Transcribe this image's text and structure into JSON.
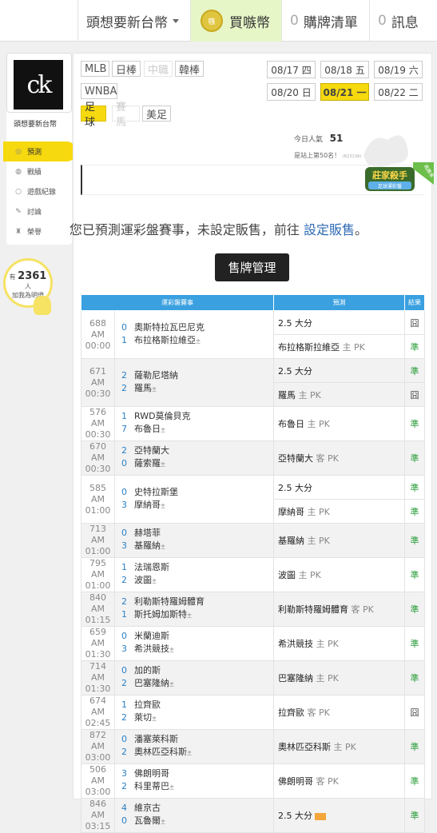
{
  "topbar": {
    "username": "頭想要新台幣",
    "buy_label": "買嗾幣",
    "coin_icon_text": "嗾",
    "cart_count": "0",
    "cart_label": "購牌清單",
    "msg_count": "0",
    "msg_label": "訊息"
  },
  "sidebar": {
    "avatar_text": "ck",
    "name": "頭想要新台幣",
    "menu": [
      {
        "label": "預測",
        "icon": "target-icon"
      },
      {
        "label": "戰績",
        "icon": "chat-icon"
      },
      {
        "label": "遊戲紀錄",
        "icon": "circle-icon"
      },
      {
        "label": "討論",
        "icon": "pencil-icon"
      },
      {
        "label": "榮譽",
        "icon": "medal-icon"
      }
    ],
    "fans_prefix": "有",
    "fans_count": "2361",
    "fans_suffix": "人",
    "fans_line2": "加我為明燈"
  },
  "leagues": [
    {
      "label": "MLB",
      "state": "normal"
    },
    {
      "label": "日棒",
      "state": "normal"
    },
    {
      "label": "中職",
      "state": "disabled"
    },
    {
      "label": "韓棒",
      "state": "normal"
    },
    {
      "label": "WNBA",
      "state": "normal"
    },
    {
      "label": "足球",
      "state": "active"
    },
    {
      "label": "賽馬",
      "state": "disabled"
    },
    {
      "label": "美足",
      "state": "normal"
    }
  ],
  "dates": [
    {
      "label": "08/17 四",
      "active": false
    },
    {
      "label": "08/18 五",
      "active": false
    },
    {
      "label": "08/19 六",
      "active": false
    },
    {
      "label": "08/20 日",
      "active": false
    },
    {
      "label": "08/21 一",
      "active": true
    },
    {
      "label": "08/22 二",
      "active": false
    }
  ],
  "popularity": {
    "label": "今日人氣",
    "value": "51",
    "rank_text": "是站上第50名！",
    "rank_code": "(R2313A)"
  },
  "badge": {
    "title": "莊家殺手",
    "sub": "足球運彩盤",
    "ribbon": "高勝率"
  },
  "notice": {
    "text": "您已預測運彩盤賽事，未設定販售，前往",
    "link": "設定販售",
    "end": "。"
  },
  "manage_button": "售牌管理",
  "table": {
    "headers": [
      "運彩盤賽事",
      "預測",
      "結果"
    ],
    "games": [
      {
        "id": "688",
        "time": "AM 00:00",
        "away": "奧斯特拉瓦巴尼克",
        "away_score": "0",
        "home": "布拉格斯拉維亞",
        "home_score": "1",
        "preds": [
          {
            "text": "2.5 大分",
            "pk": "",
            "result": "囧"
          },
          {
            "text": "布拉格斯拉維亞",
            "pk": "主 PK",
            "result": "準"
          }
        ]
      },
      {
        "id": "671",
        "time": "AM 00:30",
        "away": "薩勒尼塔納",
        "away_score": "2",
        "home": "羅馬",
        "home_score": "2",
        "preds": [
          {
            "text": "2.5 大分",
            "pk": "",
            "result": "準"
          },
          {
            "text": "羅馬",
            "pk": "主 PK",
            "result": "囧"
          }
        ]
      },
      {
        "id": "576",
        "time": "AM 00:30",
        "away": "RWD莫倫貝克",
        "away_score": "1",
        "home": "布魯日",
        "home_score": "7",
        "preds": [
          {
            "text": "布魯日",
            "pk": "主 PK",
            "result": "準"
          }
        ]
      },
      {
        "id": "670",
        "time": "AM 00:30",
        "away": "亞特蘭大",
        "away_score": "2",
        "home": "薩索羅",
        "home_score": "0",
        "preds": [
          {
            "text": "亞特蘭大",
            "pk": "客 PK",
            "result": "準"
          }
        ]
      },
      {
        "id": "585",
        "time": "AM 01:00",
        "away": "史特拉斯堡",
        "away_score": "0",
        "home": "摩納哥",
        "home_score": "3",
        "preds": [
          {
            "text": "2.5 大分",
            "pk": "",
            "result": "準"
          },
          {
            "text": "摩納哥",
            "pk": "主 PK",
            "result": "準"
          }
        ]
      },
      {
        "id": "713",
        "time": "AM 01:00",
        "away": "赫塔菲",
        "away_score": "0",
        "home": "基羅納",
        "home_score": "3",
        "preds": [
          {
            "text": "基羅納",
            "pk": "主 PK",
            "result": "準"
          }
        ]
      },
      {
        "id": "795",
        "time": "AM 01:00",
        "away": "法瑞恩斯",
        "away_score": "1",
        "home": "波圖",
        "home_score": "2",
        "preds": [
          {
            "text": "波圖",
            "pk": "主 PK",
            "result": "準"
          }
        ]
      },
      {
        "id": "840",
        "time": "AM 01:15",
        "away": "利勒斯特羅姆體育",
        "away_score": "2",
        "home": "斯托姆加斯特",
        "home_score": "1",
        "preds": [
          {
            "text": "利勒斯特羅姆體育",
            "pk": "客 PK",
            "result": "準"
          }
        ]
      },
      {
        "id": "659",
        "time": "AM 01:30",
        "away": "米蘭迪斯",
        "away_score": "0",
        "home": "希洪競技",
        "home_score": "3",
        "preds": [
          {
            "text": "希洪競技",
            "pk": "主 PK",
            "result": "準"
          }
        ]
      },
      {
        "id": "714",
        "time": "AM 01:30",
        "away": "加的斯",
        "away_score": "0",
        "home": "巴塞隆納",
        "home_score": "2",
        "preds": [
          {
            "text": "巴塞隆納",
            "pk": "主 PK",
            "result": "準"
          }
        ]
      },
      {
        "id": "674",
        "time": "AM 02:45",
        "away": "拉齊歐",
        "away_score": "1",
        "home": "萊切",
        "home_score": "2",
        "preds": [
          {
            "text": "拉齊歐",
            "pk": "客 PK",
            "result": "囧"
          }
        ]
      },
      {
        "id": "872",
        "time": "AM 03:00",
        "away": "潘塞萊科斯",
        "away_score": "0",
        "home": "奧林匹亞科斯",
        "home_score": "2",
        "preds": [
          {
            "text": "奧林匹亞科斯",
            "pk": "主 PK",
            "result": "準"
          }
        ]
      },
      {
        "id": "506",
        "time": "AM 03:00",
        "away": "佛朗明哥",
        "away_score": "3",
        "home": "科里蒂巴",
        "home_score": "2",
        "preds": [
          {
            "text": "佛朗明哥",
            "pk": "客 PK",
            "result": "準"
          }
        ]
      },
      {
        "id": "846",
        "time": "AM 03:15",
        "away": "維京古",
        "away_score": "4",
        "home": "瓦魯爾",
        "home_score": "0",
        "preds": [
          {
            "text": "2.5 大分",
            "pk": "",
            "result": "準",
            "tag": true
          }
        ]
      }
    ]
  },
  "home_mark": "主"
}
